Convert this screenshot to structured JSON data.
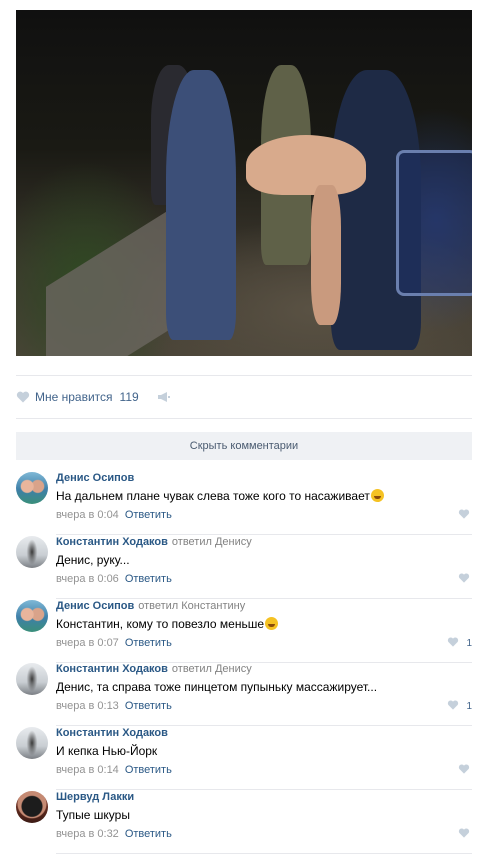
{
  "post": {
    "photo_icon": "party-photo",
    "likes": {
      "label": "Мне нравится",
      "count": "119"
    },
    "icons": {
      "like": "heart-icon",
      "share": "megaphone-icon"
    },
    "hide_comments": "Скрыть комментарии"
  },
  "colors": {
    "link": "#2a5885",
    "muted": "#939393",
    "heart": "#c5d0db"
  },
  "comments": [
    {
      "author": "Денис Осипов",
      "reply_to": "",
      "text": "На дальнем плане чувак слева тоже кого то насаживает",
      "emoji": true,
      "time": "вчера в 0:04",
      "reply": "Ответить",
      "likes": ""
    },
    {
      "author": "Константин Ходаков",
      "reply_to": "ответил Денису",
      "text": "Денис, руку...",
      "emoji": false,
      "time": "вчера в 0:06",
      "reply": "Ответить",
      "likes": ""
    },
    {
      "author": "Денис Осипов",
      "reply_to": "ответил Константину",
      "text": "Константин, кому то повезло меньше",
      "emoji": true,
      "time": "вчера в 0:07",
      "reply": "Ответить",
      "likes": "1"
    },
    {
      "author": "Константин Ходаков",
      "reply_to": "ответил Денису",
      "text": "Денис, та справа тоже пинцетом пупыньку массажирует...",
      "emoji": false,
      "time": "вчера в 0:13",
      "reply": "Ответить",
      "likes": "1"
    },
    {
      "author": "Константин Ходаков",
      "reply_to": "",
      "text": "И кепка Нью-Йорк",
      "emoji": false,
      "time": "вчера в 0:14",
      "reply": "Ответить",
      "likes": ""
    },
    {
      "author": "Шервуд Лакки",
      "reply_to": "",
      "text": "Тупые шкуры",
      "emoji": false,
      "time": "вчера в 0:32",
      "reply": "Ответить",
      "likes": ""
    }
  ]
}
